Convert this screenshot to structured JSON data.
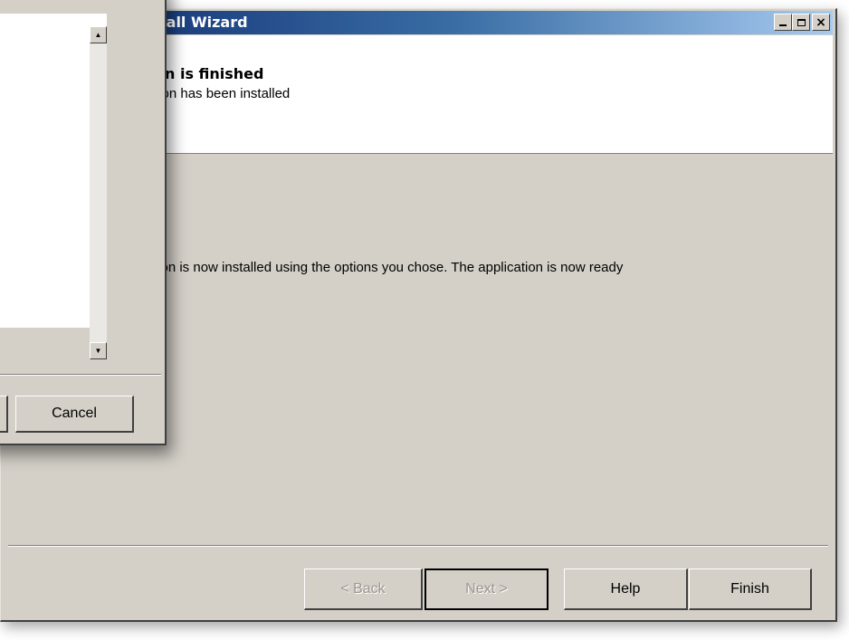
{
  "wizard": {
    "title": "tall Wizard",
    "header": {
      "title": "on is finished",
      "subtitle": "tion has been installed"
    },
    "body_text": "tion is now installed using the options you chose. The application is now ready",
    "caption_buttons": {
      "minimize_icon": "minimize-icon",
      "maximize_icon": "maximize-icon",
      "close_icon": "close-icon",
      "close_glyph": "×"
    },
    "buttons": {
      "back": "< Back",
      "next": "Next >",
      "help": "Help",
      "finish": "Finish"
    }
  },
  "dialog": {
    "buttons": {
      "cancel": "Cancel"
    },
    "scroll_up_glyph": "▲",
    "scroll_down_glyph": "▼"
  },
  "colors": {
    "titlebar_start": "#0a246a",
    "titlebar_end": "#a6caf0",
    "face": "#d4d0c8",
    "disabled_text": "#9b978f"
  }
}
